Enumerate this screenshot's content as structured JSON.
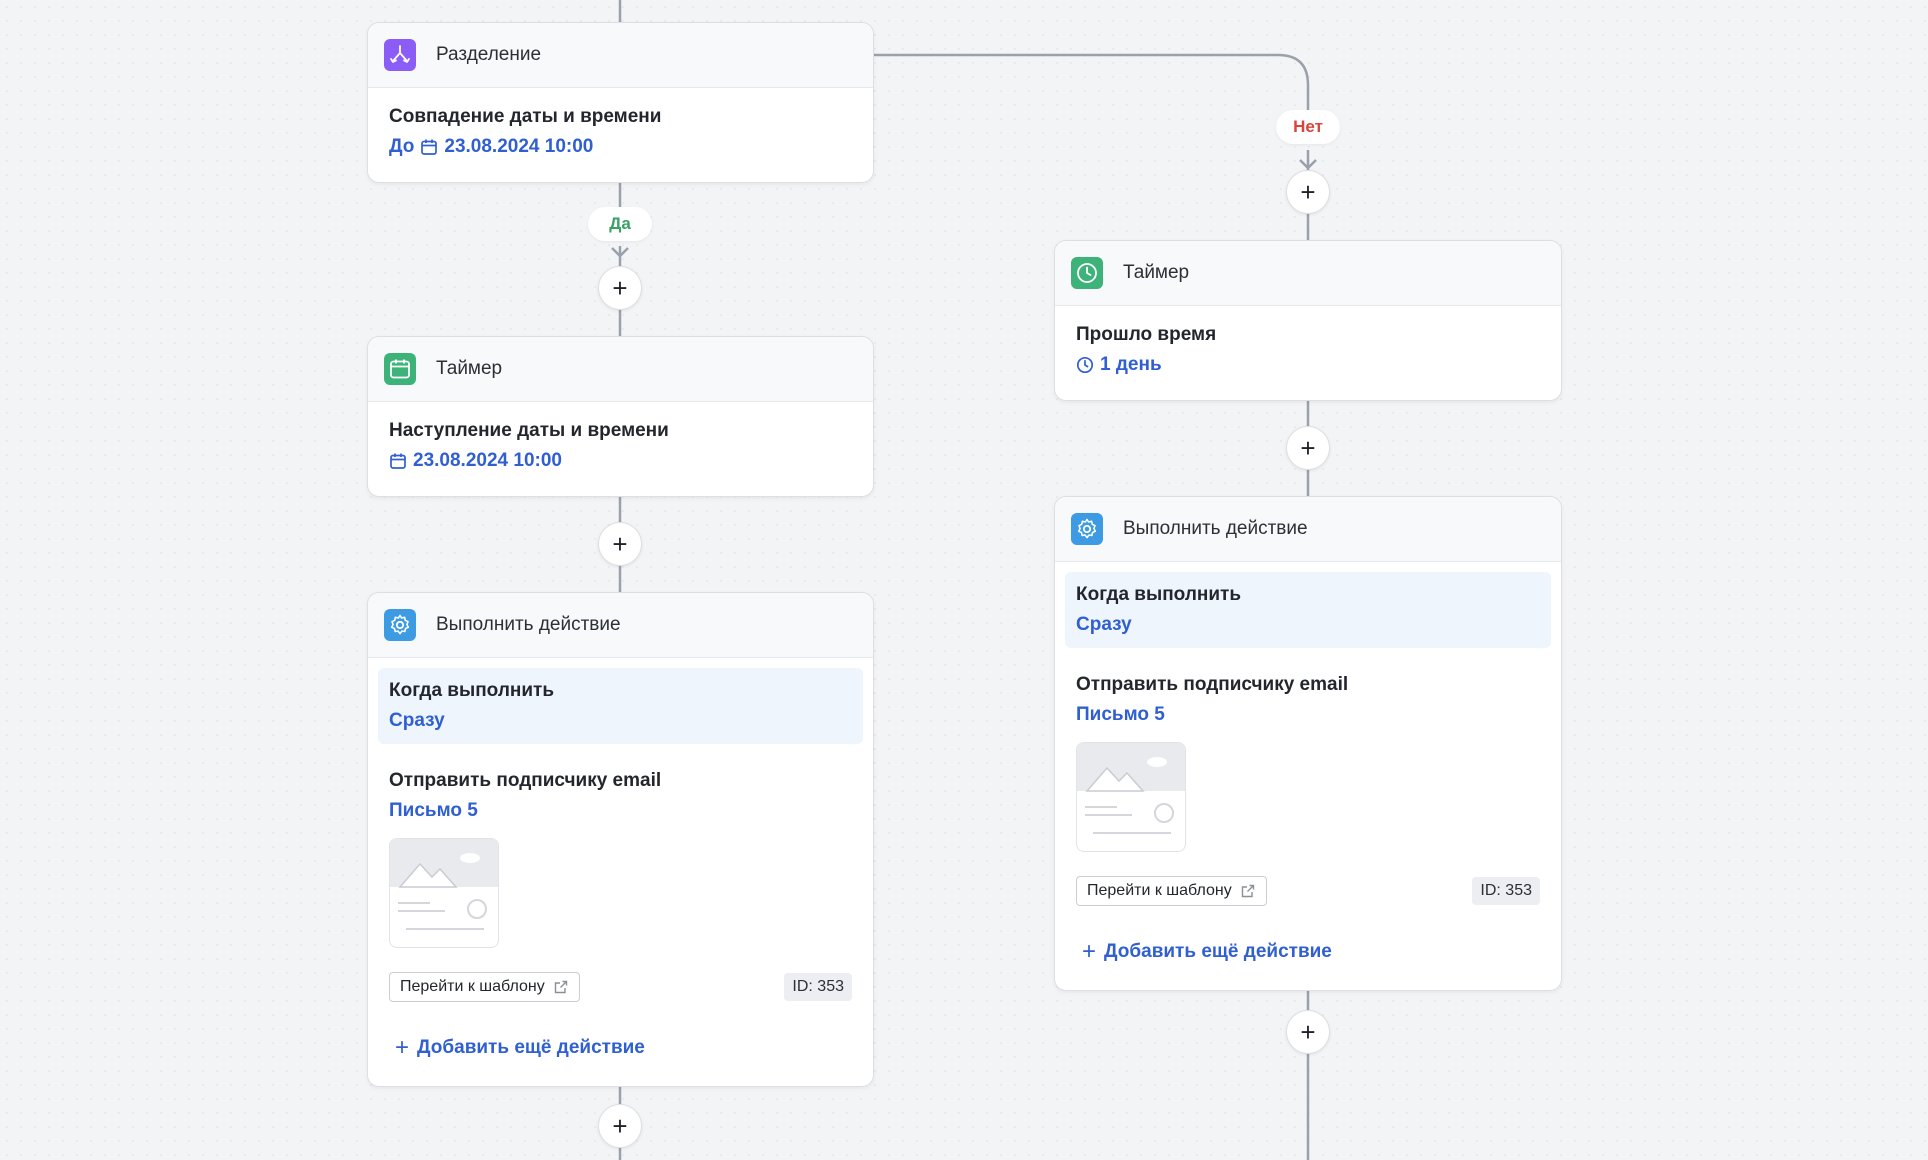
{
  "branch_labels": {
    "yes": "Да",
    "no": "Нет"
  },
  "add_step_symbol": "+",
  "split_card": {
    "icon": "split-icon",
    "title": "Разделение",
    "label": "Совпадение даты и времени",
    "value_prefix": "До",
    "value_date": "23.08.2024 10:00"
  },
  "left_branch": {
    "timer": {
      "icon": "calendar-icon",
      "title": "Таймер",
      "label": "Наступление даты и времени",
      "value": "23.08.2024 10:00"
    },
    "action": {
      "icon": "gear-icon",
      "title": "Выполнить действие",
      "when_label": "Когда выполнить",
      "when_value": "Сразу",
      "send_label": "Отправить подписчику email",
      "letter": "Письмо 5",
      "template_button": "Перейти к шаблону",
      "id_badge": "ID: 353",
      "add_more": "Добавить ещё действие"
    }
  },
  "right_branch": {
    "timer": {
      "icon": "clock-icon",
      "title": "Таймер",
      "label": "Прошло время",
      "value": "1 день"
    },
    "action": {
      "icon": "gear-icon",
      "title": "Выполнить действие",
      "when_label": "Когда выполнить",
      "when_value": "Сразу",
      "send_label": "Отправить подписчику email",
      "letter": "Письмо 5",
      "template_button": "Перейти к шаблону",
      "id_badge": "ID: 353",
      "add_more": "Добавить ещё действие"
    }
  },
  "colors": {
    "accent_blue": "#2f5fd0",
    "yes_green": "#3aa165",
    "no_red": "#d9453a",
    "split_purple": "#8b5cf6",
    "timer_green": "#3db37a",
    "action_blue": "#3c9be3"
  }
}
